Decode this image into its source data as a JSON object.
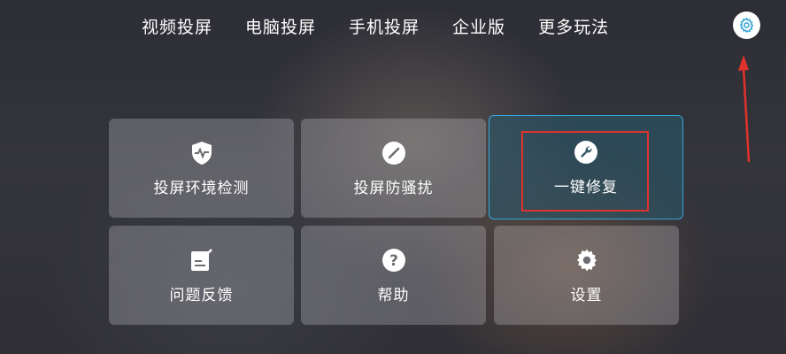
{
  "nav": {
    "items": [
      "视频投屏",
      "电脑投屏",
      "手机投屏",
      "企业版",
      "更多玩法"
    ]
  },
  "tiles": [
    {
      "label": "投屏环境检测",
      "icon": "shield-pulse-icon"
    },
    {
      "label": "投屏防骚扰",
      "icon": "prohibit-slash-icon"
    },
    {
      "label": "一键修复",
      "icon": "wrench-icon"
    },
    {
      "label": "问题反馈",
      "icon": "feedback-note-icon"
    },
    {
      "label": "帮助",
      "icon": "question-icon"
    },
    {
      "label": "设置",
      "icon": "gear-icon"
    }
  ],
  "colors": {
    "focus_border": "#35a7d8",
    "annotation_red": "#e0322c",
    "settings_icon": "#3aa6d6"
  }
}
